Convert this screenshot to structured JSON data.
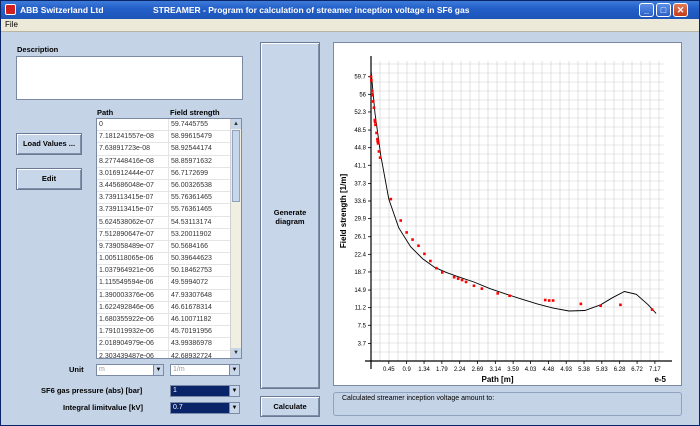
{
  "window": {
    "company": "ABB Switzerland Ltd",
    "title": "STREAMER - Program for calculation of streamer inception voltage in SF6 gas",
    "minimize_icon": "minimize-icon",
    "maximize_icon": "maximize-icon",
    "close_icon": "close-icon"
  },
  "menu": {
    "file": "File"
  },
  "left": {
    "description_label": "Description",
    "load_values_label": "Load Values ...",
    "edit_label": "Edit",
    "grid_headers": [
      "Path",
      "Field strength"
    ],
    "grid_rows": [
      [
        "0",
        "59.7445755"
      ],
      [
        "7.181241557e-08",
        "58.99615479"
      ],
      [
        "7.63891723e-08",
        "58.92544174"
      ],
      [
        "8.277448416e-08",
        "58.85971632"
      ],
      [
        "3.016912444e-07",
        "56.7172699"
      ],
      [
        "3.445686048e-07",
        "56.00326538"
      ],
      [
        "3.739113415e-07",
        "55.76361465"
      ],
      [
        "3.739113415e-07",
        "55.76361465"
      ],
      [
        "5.624538062e-07",
        "54.53113174"
      ],
      [
        "7.512890647e-07",
        "53.20011902"
      ],
      [
        "9.739058489e-07",
        "50.5684166"
      ],
      [
        "1.005118065e-06",
        "50.39644623"
      ],
      [
        "1.037964921e-06",
        "50.18462753"
      ],
      [
        "1.115549594e-06",
        "49.5994072"
      ],
      [
        "1.390003376e-06",
        "47.93307648"
      ],
      [
        "1.622492846e-06",
        "46.61678314"
      ],
      [
        "1.680355922e-06",
        "46.10071182"
      ],
      [
        "1.791019932e-06",
        "45.70191956"
      ],
      [
        "2.018904979e-06",
        "43.99386978"
      ],
      [
        "2.303439487e-06",
        "42.68932724"
      ]
    ],
    "unit_label": "Unit",
    "unit_path": "m",
    "unit_field": "1/m",
    "sf6_label": "SF6 gas pressure (abs) [bar]",
    "sf6_value": "1",
    "integral_label": "Integral limitvalue [kV]",
    "integral_value": "0.7"
  },
  "buttons": {
    "generate": "Generate diagram",
    "calculate": "Calculate"
  },
  "result": {
    "label": "Calculated streamer inception voltage amount to:"
  },
  "chart_data": {
    "type": "scatter",
    "xlabel": "Path [m]",
    "ylabel": "Field strength [1/m]",
    "x_exponent_label": "e-5",
    "xticks": [
      "0.45",
      "0.9",
      "1.34",
      "1.79",
      "2.24",
      "2.69",
      "3.14",
      "3.59",
      "4.03",
      "4.48",
      "4.93",
      "5.38",
      "5.83",
      "6.28",
      "6.72",
      "7.17"
    ],
    "yticks": [
      "59.7",
      "56",
      "52.3",
      "48.5",
      "44.8",
      "41.1",
      "37.3",
      "33.6",
      "29.9",
      "26.1",
      "22.4",
      "18.7",
      "14.9",
      "11.2",
      "7.5",
      "3.7"
    ],
    "xlim": [
      0,
      7.4
    ],
    "ylim": [
      0,
      63
    ],
    "grid": true,
    "points_x": [
      0,
      0.007,
      0.008,
      0.03,
      0.034,
      0.037,
      0.056,
      0.075,
      0.097,
      0.1,
      0.104,
      0.112,
      0.139,
      0.162,
      0.168,
      0.179,
      0.2,
      0.23,
      0.5,
      0.75,
      0.9,
      1.05,
      1.2,
      1.35,
      1.5,
      1.65,
      1.8,
      2.1,
      2.2,
      2.3,
      2.4,
      2.6,
      2.8,
      3.2,
      3.5,
      4.4,
      4.5,
      4.6,
      5.3,
      5.8,
      6.3,
      7.1
    ],
    "points_y": [
      59.7,
      59.0,
      58.9,
      56.7,
      56.0,
      55.8,
      54.5,
      53.2,
      50.6,
      50.4,
      50.2,
      49.6,
      47.9,
      46.6,
      46.1,
      45.7,
      44.0,
      42.7,
      34.0,
      29.5,
      27.0,
      25.5,
      24.2,
      22.5,
      21.0,
      19.5,
      18.6,
      17.6,
      17.3,
      17.0,
      16.6,
      15.8,
      15.2,
      14.2,
      13.7,
      12.8,
      12.7,
      12.7,
      12.0,
      11.6,
      11.8,
      10.8
    ],
    "fit_x": [
      0,
      0.1,
      0.25,
      0.45,
      0.7,
      1.0,
      1.3,
      1.6,
      1.9,
      2.2,
      2.6,
      3.0,
      3.4,
      3.8,
      4.2,
      4.6,
      5.0,
      5.4,
      5.8,
      6.1,
      6.4,
      6.7,
      7.0,
      7.2
    ],
    "fit_y": [
      61,
      52,
      43,
      34,
      28,
      24,
      21.5,
      19.7,
      18.6,
      17.7,
      16.6,
      15.2,
      14.1,
      13.0,
      12.0,
      11.1,
      10.5,
      10.6,
      11.8,
      13.3,
      14.6,
      14.0,
      11.8,
      10.0
    ],
    "marker_color": "#ff0000",
    "line_color": "#000000"
  }
}
